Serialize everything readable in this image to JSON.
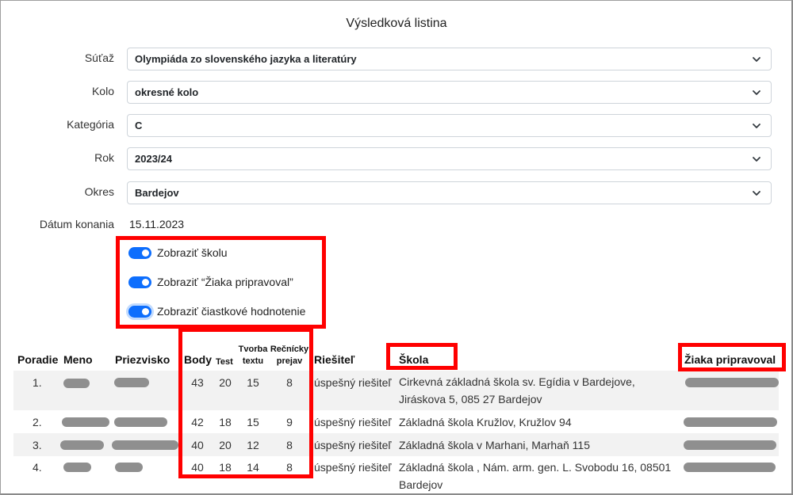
{
  "title": "Výsledková listina",
  "filters": [
    {
      "label": "Súťaž",
      "value": "Olympiáda zo slovenského jazyka a literatúry"
    },
    {
      "label": "Kolo",
      "value": "okresné kolo"
    },
    {
      "label": "Kategória",
      "value": "C"
    },
    {
      "label": "Rok",
      "value": "2023/24"
    },
    {
      "label": "Okres",
      "value": "Bardejov"
    }
  ],
  "date": {
    "label": "Dátum konania",
    "value": "15.11.2023"
  },
  "toggles": [
    {
      "label": "Zobraziť školu",
      "on": true
    },
    {
      "label": "Zobraziť “Žiaka pripravoval”",
      "on": true
    },
    {
      "label": "Zobraziť čiastkové hodnotenie",
      "on": true
    }
  ],
  "table": {
    "headers": {
      "poradie": "Poradie",
      "meno": "Meno",
      "priezvisko": "Priezvisko",
      "body": "Body",
      "test": "Test",
      "tvorba": "Tvorba textu",
      "recnicky": "Rečnícky prejav",
      "riesitel": "Riešiteľ",
      "skola": "Škola",
      "pripravoval": "Žiaka pripravoval"
    },
    "rows": [
      {
        "poradie": "1.",
        "body": "43",
        "test": "20",
        "tvorba": "15",
        "recnicky": "8",
        "riesitel": "úspešný riešiteľ",
        "skola": "Cirkevná základná škola sv. Egídia v Bardejove, Jiráskova 5, 085 27 Bardejov"
      },
      {
        "poradie": "2.",
        "body": "42",
        "test": "18",
        "tvorba": "15",
        "recnicky": "9",
        "riesitel": "úspešný riešiteľ",
        "skola": "Základná škola Kružlov, Kružlov 94"
      },
      {
        "poradie": "3.",
        "body": "40",
        "test": "20",
        "tvorba": "12",
        "recnicky": "8",
        "riesitel": "úspešný riešiteľ",
        "skola": "Základná škola v Marhani, Marhaň 115"
      },
      {
        "poradie": "4.",
        "body": "40",
        "test": "18",
        "tvorba": "14",
        "recnicky": "8",
        "riesitel": "úspešný riešiteľ",
        "skola": "Základná škola , Nám. arm. gen. L. Svobodu 16, 08501 Bardejov"
      }
    ]
  },
  "colors": {
    "accent": "#0d6efd",
    "highlight": "#ff0000",
    "redacted": "#8f8f8f"
  },
  "icons": {
    "select": "chevron-down-icon"
  }
}
